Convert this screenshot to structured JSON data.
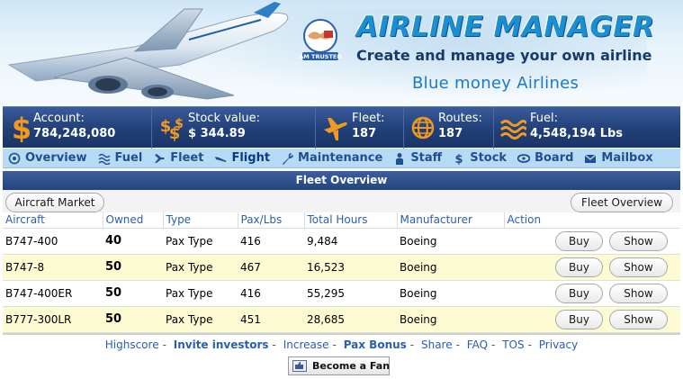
{
  "header": {
    "trusted_badge": "AM TRUSTED",
    "title": "AIRLINE MANAGER",
    "tagline": "Create and manage your own airline",
    "airline_name": "Blue money Airlines"
  },
  "stats": [
    {
      "icon": "dollar-icon",
      "label": "Account:",
      "value": "784,248,080"
    },
    {
      "icon": "stock-dollars-icon",
      "label": "Stock value:",
      "value": "$ 344.89"
    },
    {
      "icon": "airplane-icon",
      "label": "Fleet:",
      "value": "187"
    },
    {
      "icon": "globe-icon",
      "label": "Routes:",
      "value": "187"
    },
    {
      "icon": "fuel-waves-icon",
      "label": "Fuel:",
      "value": "4,548,194 Lbs"
    }
  ],
  "nav": [
    {
      "icon": "overview-icon",
      "label": "Overview"
    },
    {
      "icon": "fuel-icon",
      "label": "Fuel"
    },
    {
      "icon": "fleet-icon",
      "label": "Fleet"
    },
    {
      "icon": "flight-icon",
      "label": "Flight"
    },
    {
      "icon": "wrench-icon",
      "label": "Maintenance"
    },
    {
      "icon": "staff-icon",
      "label": "Staff"
    },
    {
      "icon": "stock-icon",
      "label": "Stock"
    },
    {
      "icon": "board-icon",
      "label": "Board"
    },
    {
      "icon": "mailbox-icon",
      "label": "Mailbox"
    }
  ],
  "panel": {
    "title": "Fleet Overview",
    "aircraft_market_label": "Aircraft Market",
    "fleet_overview_label": "Fleet Overview"
  },
  "table": {
    "columns": [
      "Aircraft",
      "Owned",
      "Type",
      "Pax/Lbs",
      "Total Hours",
      "Manufacturer",
      "Action"
    ],
    "rows": [
      {
        "aircraft": "B747-400",
        "owned": "40",
        "type": "Pax Type",
        "pax": "416",
        "hours": "9,484",
        "manufacturer": "Boeing",
        "buy": "Buy",
        "show": "Show"
      },
      {
        "aircraft": "B747-8",
        "owned": "50",
        "type": "Pax Type",
        "pax": "467",
        "hours": "16,523",
        "manufacturer": "Boeing",
        "buy": "Buy",
        "show": "Show"
      },
      {
        "aircraft": "B747-400ER",
        "owned": "50",
        "type": "Pax Type",
        "pax": "416",
        "hours": "55,295",
        "manufacturer": "Boeing",
        "buy": "Buy",
        "show": "Show"
      },
      {
        "aircraft": "B777-300LR",
        "owned": "50",
        "type": "Pax Type",
        "pax": "451",
        "hours": "28,685",
        "manufacturer": "Boeing",
        "buy": "Buy",
        "show": "Show"
      }
    ]
  },
  "footer": {
    "links": [
      {
        "label": "Highscore",
        "bold": false
      },
      {
        "label": "Invite investors",
        "bold": true
      },
      {
        "label": "Increase",
        "bold": false
      },
      {
        "label": "Pax Bonus",
        "bold": true
      },
      {
        "label": "Share",
        "bold": false
      },
      {
        "label": "FAQ",
        "bold": false
      },
      {
        "label": "TOS",
        "bold": false
      },
      {
        "label": "Privacy",
        "bold": false
      }
    ],
    "separator": "-",
    "fan_button": "Become a Fan"
  },
  "colors": {
    "stats_bar": "#213f78",
    "nav_bar": "#b7dbf5",
    "link_blue": "#2a5fb0",
    "row_highlight": "#fdfbd2"
  }
}
